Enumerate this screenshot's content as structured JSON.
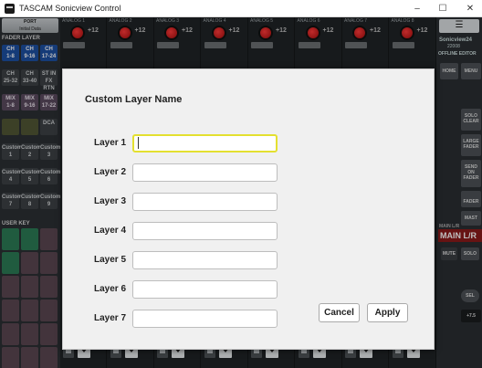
{
  "window": {
    "title": "TASCAM Sonicview Control",
    "minimize_glyph": "–",
    "maximize_glyph": "☐",
    "close_glyph": "✕"
  },
  "background": {
    "port_label": "PORT",
    "port_sub": "Initial Data",
    "fader_layer_label": "FADER LAYER",
    "layer_buttons": [
      {
        "l1": "CH",
        "l2": "1-8",
        "style": "ch-blue"
      },
      {
        "l1": "CH",
        "l2": "9-16",
        "style": "ch-blue"
      },
      {
        "l1": "CH",
        "l2": "17-24",
        "style": "ch-blue"
      },
      {
        "l1": "CH",
        "l2": "25-32",
        "style": "ch-dark"
      },
      {
        "l1": "CH",
        "l2": "33-40",
        "style": "ch-dark"
      },
      {
        "l1": "ST IN",
        "l2": "FX RTN",
        "style": "ch-dark"
      },
      {
        "l1": "MIX",
        "l2": "1-8",
        "style": "ch-mix"
      },
      {
        "l1": "MIX",
        "l2": "9-16",
        "style": "ch-mix"
      },
      {
        "l1": "MIX",
        "l2": "17-22",
        "style": "ch-mix"
      },
      {
        "l1": "",
        "l2": "",
        "style": "ch-olive"
      },
      {
        "l1": "",
        "l2": "",
        "style": "ch-olive"
      },
      {
        "l1": "DCA",
        "l2": "",
        "style": "ch-dark"
      },
      {
        "l1": "Custom",
        "l2": "1",
        "style": "ch-dark"
      },
      {
        "l1": "Custom",
        "l2": "2",
        "style": "ch-dark"
      },
      {
        "l1": "Custom",
        "l2": "3",
        "style": "ch-dark"
      },
      {
        "l1": "Custom",
        "l2": "4",
        "style": "ch-dark"
      },
      {
        "l1": "Custom",
        "l2": "5",
        "style": "ch-dark"
      },
      {
        "l1": "Custom",
        "l2": "6",
        "style": "ch-dark"
      },
      {
        "l1": "Custom",
        "l2": "7",
        "style": "ch-dark"
      },
      {
        "l1": "Custom",
        "l2": "8",
        "style": "ch-dark"
      },
      {
        "l1": "Custom",
        "l2": "9",
        "style": "ch-dark"
      }
    ],
    "user_key_label": "USER KEY",
    "channel_heads": [
      "ANALOG 1",
      "ANALOG 2",
      "ANALOG 3",
      "ANALOG 4",
      "ANALOG 5",
      "ANALOG 6",
      "ANALOG 7",
      "ANALOG 8"
    ],
    "gain_label": "+12",
    "right": {
      "menu_glyph": "☰",
      "device_name": "Sonicview24",
      "device_sub": "22008",
      "offline_label": "OFFLINE EDITOR",
      "home": "HOME",
      "menu": "MENU",
      "solo_clear": "SOLO CLEAR",
      "large_fader": "LARGE FADER",
      "send_on_fader": "SEND ON FADER",
      "fader": "FADER",
      "master": "MAST",
      "main_lr_small": "MAIN L/R",
      "main_lr": "MAIN L/R",
      "mute": "MUTE",
      "solo": "SOLO",
      "sel": "SEL",
      "level": "+7.5"
    }
  },
  "dialog": {
    "title": "Custom Layer Name",
    "layers": [
      {
        "label": "Layer 1",
        "value": "",
        "placeholder": ""
      },
      {
        "label": "Layer 2",
        "value": "",
        "placeholder": ""
      },
      {
        "label": "Layer 3",
        "value": "",
        "placeholder": ""
      },
      {
        "label": "Layer 4",
        "value": "",
        "placeholder": ""
      },
      {
        "label": "Layer 5",
        "value": "",
        "placeholder": ""
      },
      {
        "label": "Layer 6",
        "value": "",
        "placeholder": ""
      },
      {
        "label": "Layer 7",
        "value": "",
        "placeholder": ""
      }
    ],
    "cancel_label": "Cancel",
    "apply_label": "Apply",
    "focus_color": "#e4e030"
  }
}
